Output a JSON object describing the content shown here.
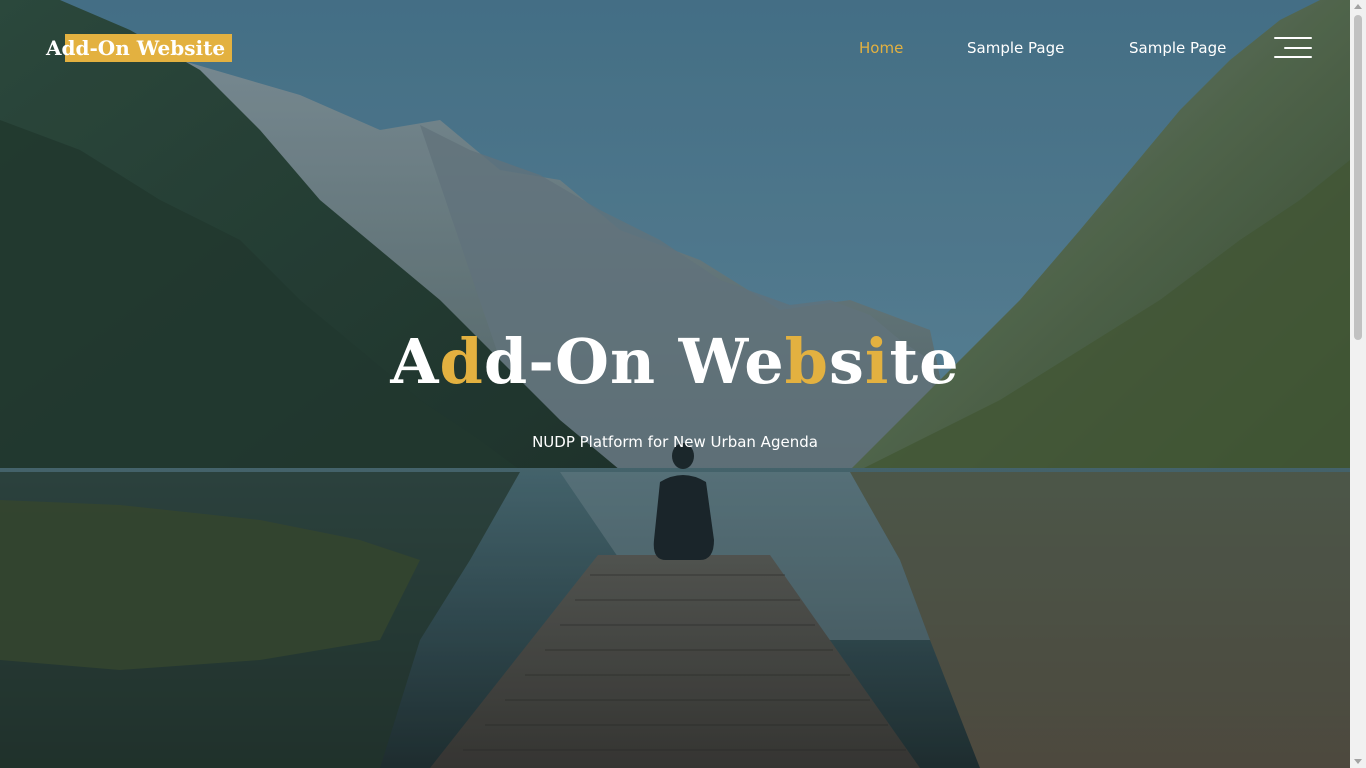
{
  "header": {
    "brand": "Add-On Website",
    "nav": [
      {
        "label": "Home",
        "active": true
      },
      {
        "label": "Sample Page",
        "active": false
      },
      {
        "label": "Sample Page",
        "active": false
      }
    ],
    "menu_icon": "hamburger-menu-icon"
  },
  "hero": {
    "title_parts": [
      "A",
      "d",
      "d-On We",
      "b",
      "s",
      "i",
      "te"
    ],
    "title_highlight_indices": [
      1,
      3,
      5
    ],
    "subtitle": "NUDP Platform for New Urban Agenda",
    "background": "mountain lake with wooden pier and seated person"
  },
  "colors": {
    "accent": "#e3b140",
    "text": "#ffffff"
  }
}
